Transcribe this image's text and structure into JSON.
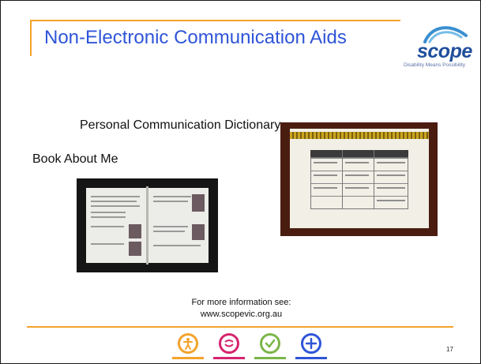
{
  "slide": {
    "title": "Non-Electronic Communication Aids",
    "logo": {
      "wordmark": "scope",
      "tagline": "Disability Means Possibility"
    },
    "labels": {
      "personal_dictionary": "Personal Communication Dictionary",
      "book_about_me": "Book About Me"
    },
    "more_info": {
      "line1": "For more information see:",
      "line2": "www.scopevic.org.au"
    },
    "page_number": "17",
    "footer_icons": [
      {
        "name": "accessibility-icon",
        "color": "#f2a32b"
      },
      {
        "name": "smile-icon",
        "color": "#d6246e"
      },
      {
        "name": "checkmark-icon",
        "color": "#7ab648"
      },
      {
        "name": "plus-icon",
        "color": "#2f55d8"
      }
    ],
    "colors": {
      "title": "#2f55d8",
      "accent_line": "#f2a32b",
      "logo": "#1f4e9c"
    }
  }
}
